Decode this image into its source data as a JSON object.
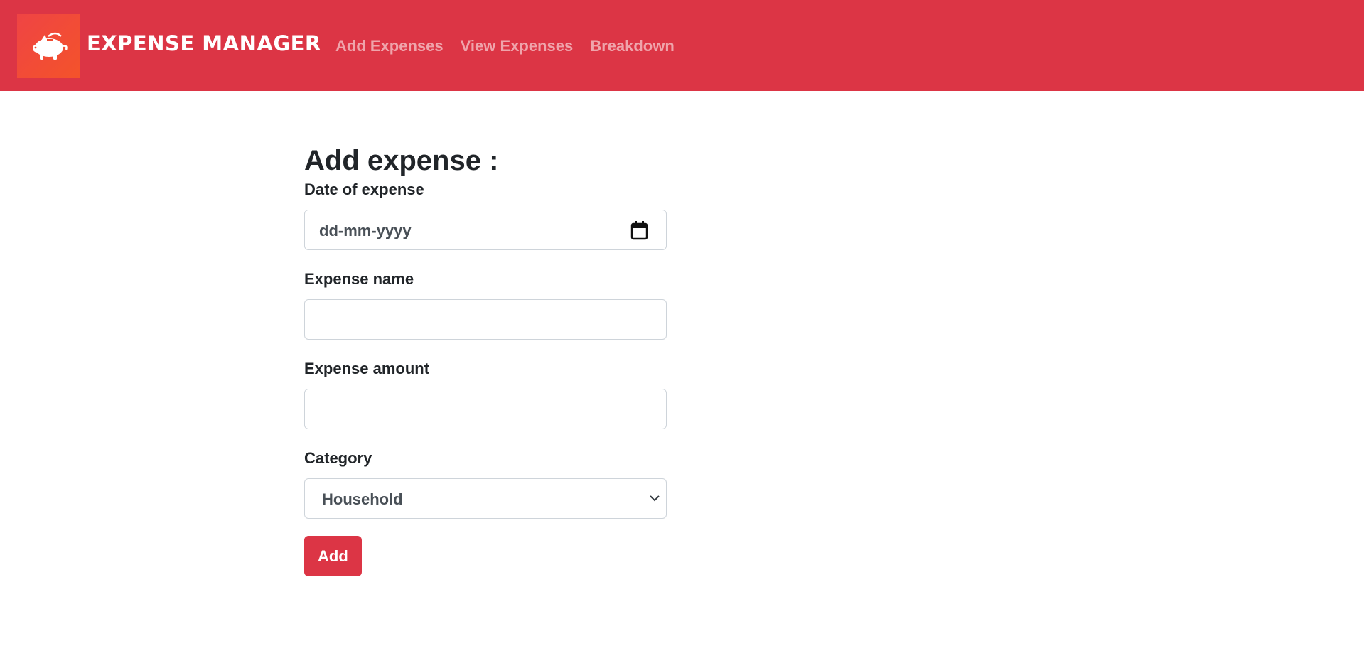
{
  "header": {
    "brand": "EXPENSE MANAGER",
    "logo_icon": "piggy-bank-icon",
    "nav": [
      {
        "label": "Add Expenses"
      },
      {
        "label": "View Expenses"
      },
      {
        "label": "Breakdown"
      }
    ],
    "colors": {
      "navbar": "#dc3545",
      "logo": "#f04a30"
    }
  },
  "form": {
    "title": "Add expense :",
    "date": {
      "label": "Date of expense",
      "placeholder": "dd-mm-yyyy",
      "icon": "calendar-icon"
    },
    "name": {
      "label": "Expense name",
      "value": ""
    },
    "amount": {
      "label": "Expense amount",
      "value": ""
    },
    "category": {
      "label": "Category",
      "selected": "Household",
      "icon": "chevron-down-icon"
    },
    "submit_label": "Add"
  }
}
